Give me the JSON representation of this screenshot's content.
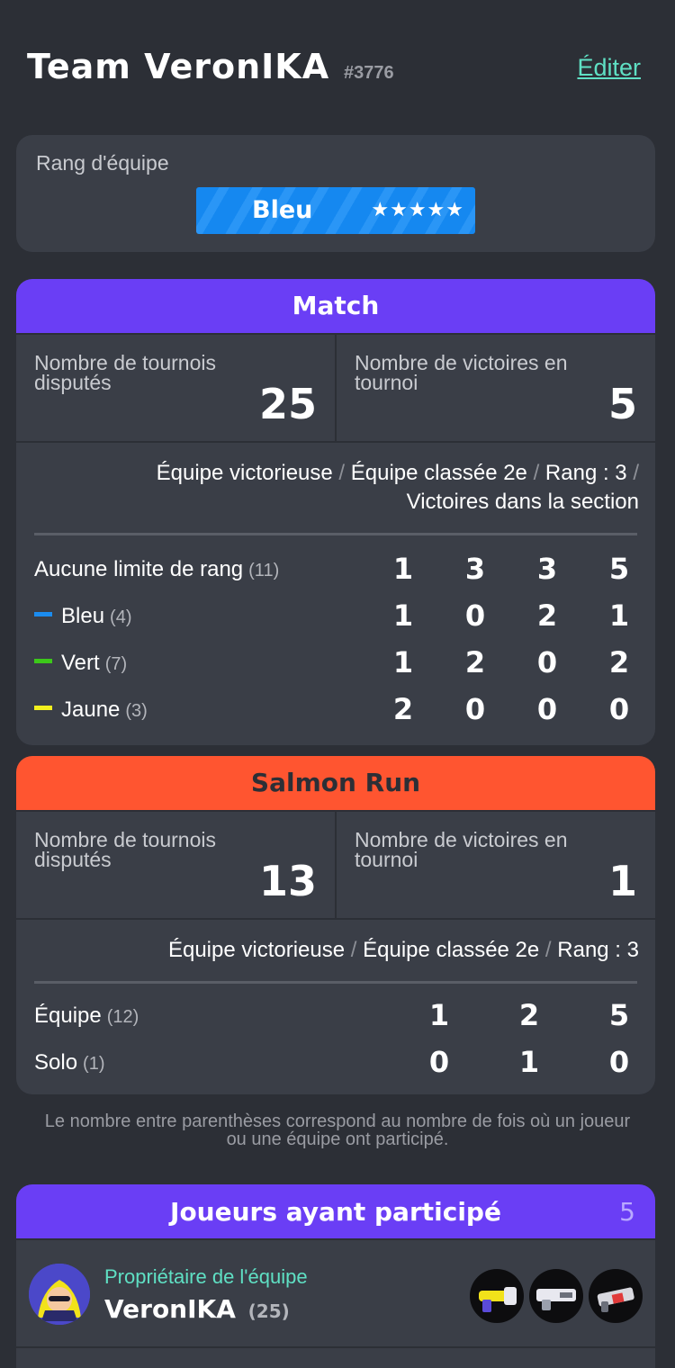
{
  "header": {
    "team_name": "Team VeronIKA",
    "team_id": "#3776",
    "edit_label": "Éditer"
  },
  "rank": {
    "label": "Rang d'équipe",
    "name": "Bleu",
    "stars": "★★★★★"
  },
  "match": {
    "title": "Match",
    "tournaments_label": "Nombre de tournois disputés",
    "tournaments_value": "25",
    "wins_label": "Nombre de victoires en tournoi",
    "wins_value": "5",
    "legend": {
      "a": "Équipe victorieuse",
      "b": "Équipe classée 2e",
      "c": "Rang : 3",
      "d": "Victoires dans la section",
      "sep": "/"
    },
    "rows": [
      {
        "label": "Aucune limite de rang",
        "count": "(11)",
        "color": "",
        "values": [
          "1",
          "3",
          "3",
          "5"
        ]
      },
      {
        "label": "Bleu",
        "count": "(4)",
        "color": "#1b8cf0",
        "values": [
          "1",
          "0",
          "2",
          "1"
        ]
      },
      {
        "label": "Vert",
        "count": "(7)",
        "color": "#3cc81a",
        "values": [
          "1",
          "2",
          "0",
          "2"
        ]
      },
      {
        "label": "Jaune",
        "count": "(3)",
        "color": "#f2ef1e",
        "values": [
          "2",
          "0",
          "0",
          "0"
        ]
      }
    ]
  },
  "salmon": {
    "title": "Salmon Run",
    "tournaments_label": "Nombre de tournois disputés",
    "tournaments_value": "13",
    "wins_label": "Nombre de victoires en tournoi",
    "wins_value": "1",
    "legend": {
      "a": "Équipe victorieuse",
      "b": "Équipe classée 2e",
      "c": "Rang : 3",
      "sep": "/"
    },
    "rows": [
      {
        "label": "Équipe",
        "count": "(12)",
        "values": [
          "1",
          "2",
          "5"
        ]
      },
      {
        "label": "Solo",
        "count": "(1)",
        "values": [
          "0",
          "1",
          "0"
        ]
      }
    ]
  },
  "note": "Le nombre entre parenthèses correspond au nombre de fois où un joueur ou une équipe ont participé.",
  "players": {
    "title": "Joueurs ayant participé",
    "count": "5",
    "owner_label": "Propriétaire de l'équipe",
    "name": "VeronIKA",
    "participations": "(25)"
  },
  "colors": {
    "background": "#2c2f36",
    "card": "#3a3e47",
    "match": "#6a3ef5",
    "salmon": "#ff5530",
    "accent": "#5fe0c4",
    "rank_blue": "#1588f0"
  }
}
